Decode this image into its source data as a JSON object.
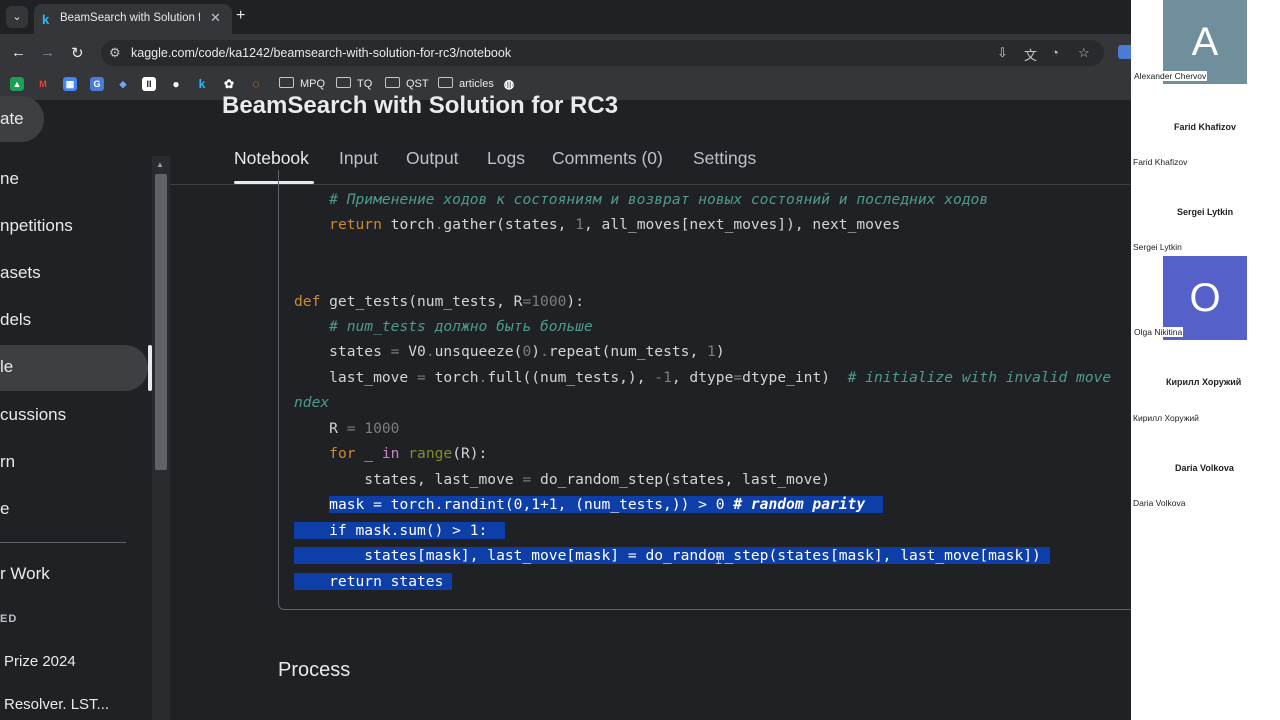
{
  "browser": {
    "tab_title": "BeamSearch with Solution for R",
    "tab_favicon": "k",
    "url": "kaggle.com/code/ka1242/beamsearch-with-solution-for-rc3/notebook",
    "bookmarks": [
      {
        "label": "MPQ"
      },
      {
        "label": "TQ"
      },
      {
        "label": "QST"
      },
      {
        "label": "articles"
      }
    ]
  },
  "sidebar": {
    "create_label": "ate",
    "items": [
      {
        "label": "ne"
      },
      {
        "label": "npetitions"
      },
      {
        "label": "asets"
      },
      {
        "label": "dels"
      },
      {
        "label": "le"
      },
      {
        "label": "cussions"
      },
      {
        "label": "rn"
      },
      {
        "label": "e"
      }
    ],
    "your_work": "r Work",
    "section_label": "ED",
    "recent": [
      {
        "label": "Prize 2024"
      },
      {
        "label": "Resolver. LST..."
      }
    ]
  },
  "notebook": {
    "title": "BeamSearch with Solution for RC3",
    "tabs": [
      {
        "label": "Notebook"
      },
      {
        "label": "Input"
      },
      {
        "label": "Output"
      },
      {
        "label": "Logs"
      },
      {
        "label": "Comments (0)"
      },
      {
        "label": "Settings"
      }
    ],
    "next_section": "Process"
  },
  "participants": [
    {
      "name": "Alexander Chervov",
      "initial": "A",
      "color": "#6f8f9d"
    },
    {
      "name": "Farid Khafizov",
      "caption": "Farid Khafizov"
    },
    {
      "name": "Sergei Lytkin",
      "caption": "Sergei Lytkin"
    },
    {
      "name": "Olga Nikitina",
      "initial": "O",
      "color": "#5560c9"
    },
    {
      "name": "Кирилл Хоружий",
      "caption": "Кирилл Хоружий"
    },
    {
      "name": "Daria Volkova",
      "caption": "Daria Volkova"
    }
  ]
}
